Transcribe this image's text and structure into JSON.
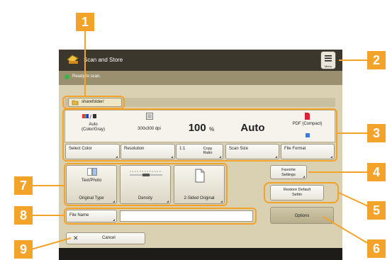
{
  "header": {
    "title": "Scan and Store",
    "menu_label": "Menu"
  },
  "status": {
    "text": "Ready to scan."
  },
  "location": {
    "path": "sharefolder/"
  },
  "summary": {
    "color_mode": "Auto (Color/Gray)",
    "resolution": "300x300 dpi",
    "ratio_value": "100",
    "ratio_unit": "%",
    "scan_size": "Auto",
    "file_format": "PDF (Compact)"
  },
  "settings_buttons": {
    "select_color": "Select Color",
    "resolution": "Resolution",
    "ratio_prefix": "1:1",
    "copy_ratio": "Copy Ratio",
    "scan_size": "Scan Size",
    "file_format": "File Format"
  },
  "tiles": {
    "original_type_value": "Text/Photo",
    "original_type": "Original Type",
    "density": "Density",
    "two_sided": "2-Sided Original"
  },
  "right_buttons": {
    "favorite": "Favorite Settings",
    "restore": "Restore Default Settin",
    "options": "Options"
  },
  "file_name": {
    "label": "File Name",
    "value": ""
  },
  "cancel": {
    "label": "Cancel"
  },
  "callouts": [
    "1",
    "2",
    "3",
    "4",
    "5",
    "6",
    "7",
    "8",
    "9"
  ],
  "colors": {
    "accent": "#f3a22a",
    "panel": "#d9d1b2",
    "titlebar": "#3b372c",
    "status_dot": "#3db34a"
  }
}
